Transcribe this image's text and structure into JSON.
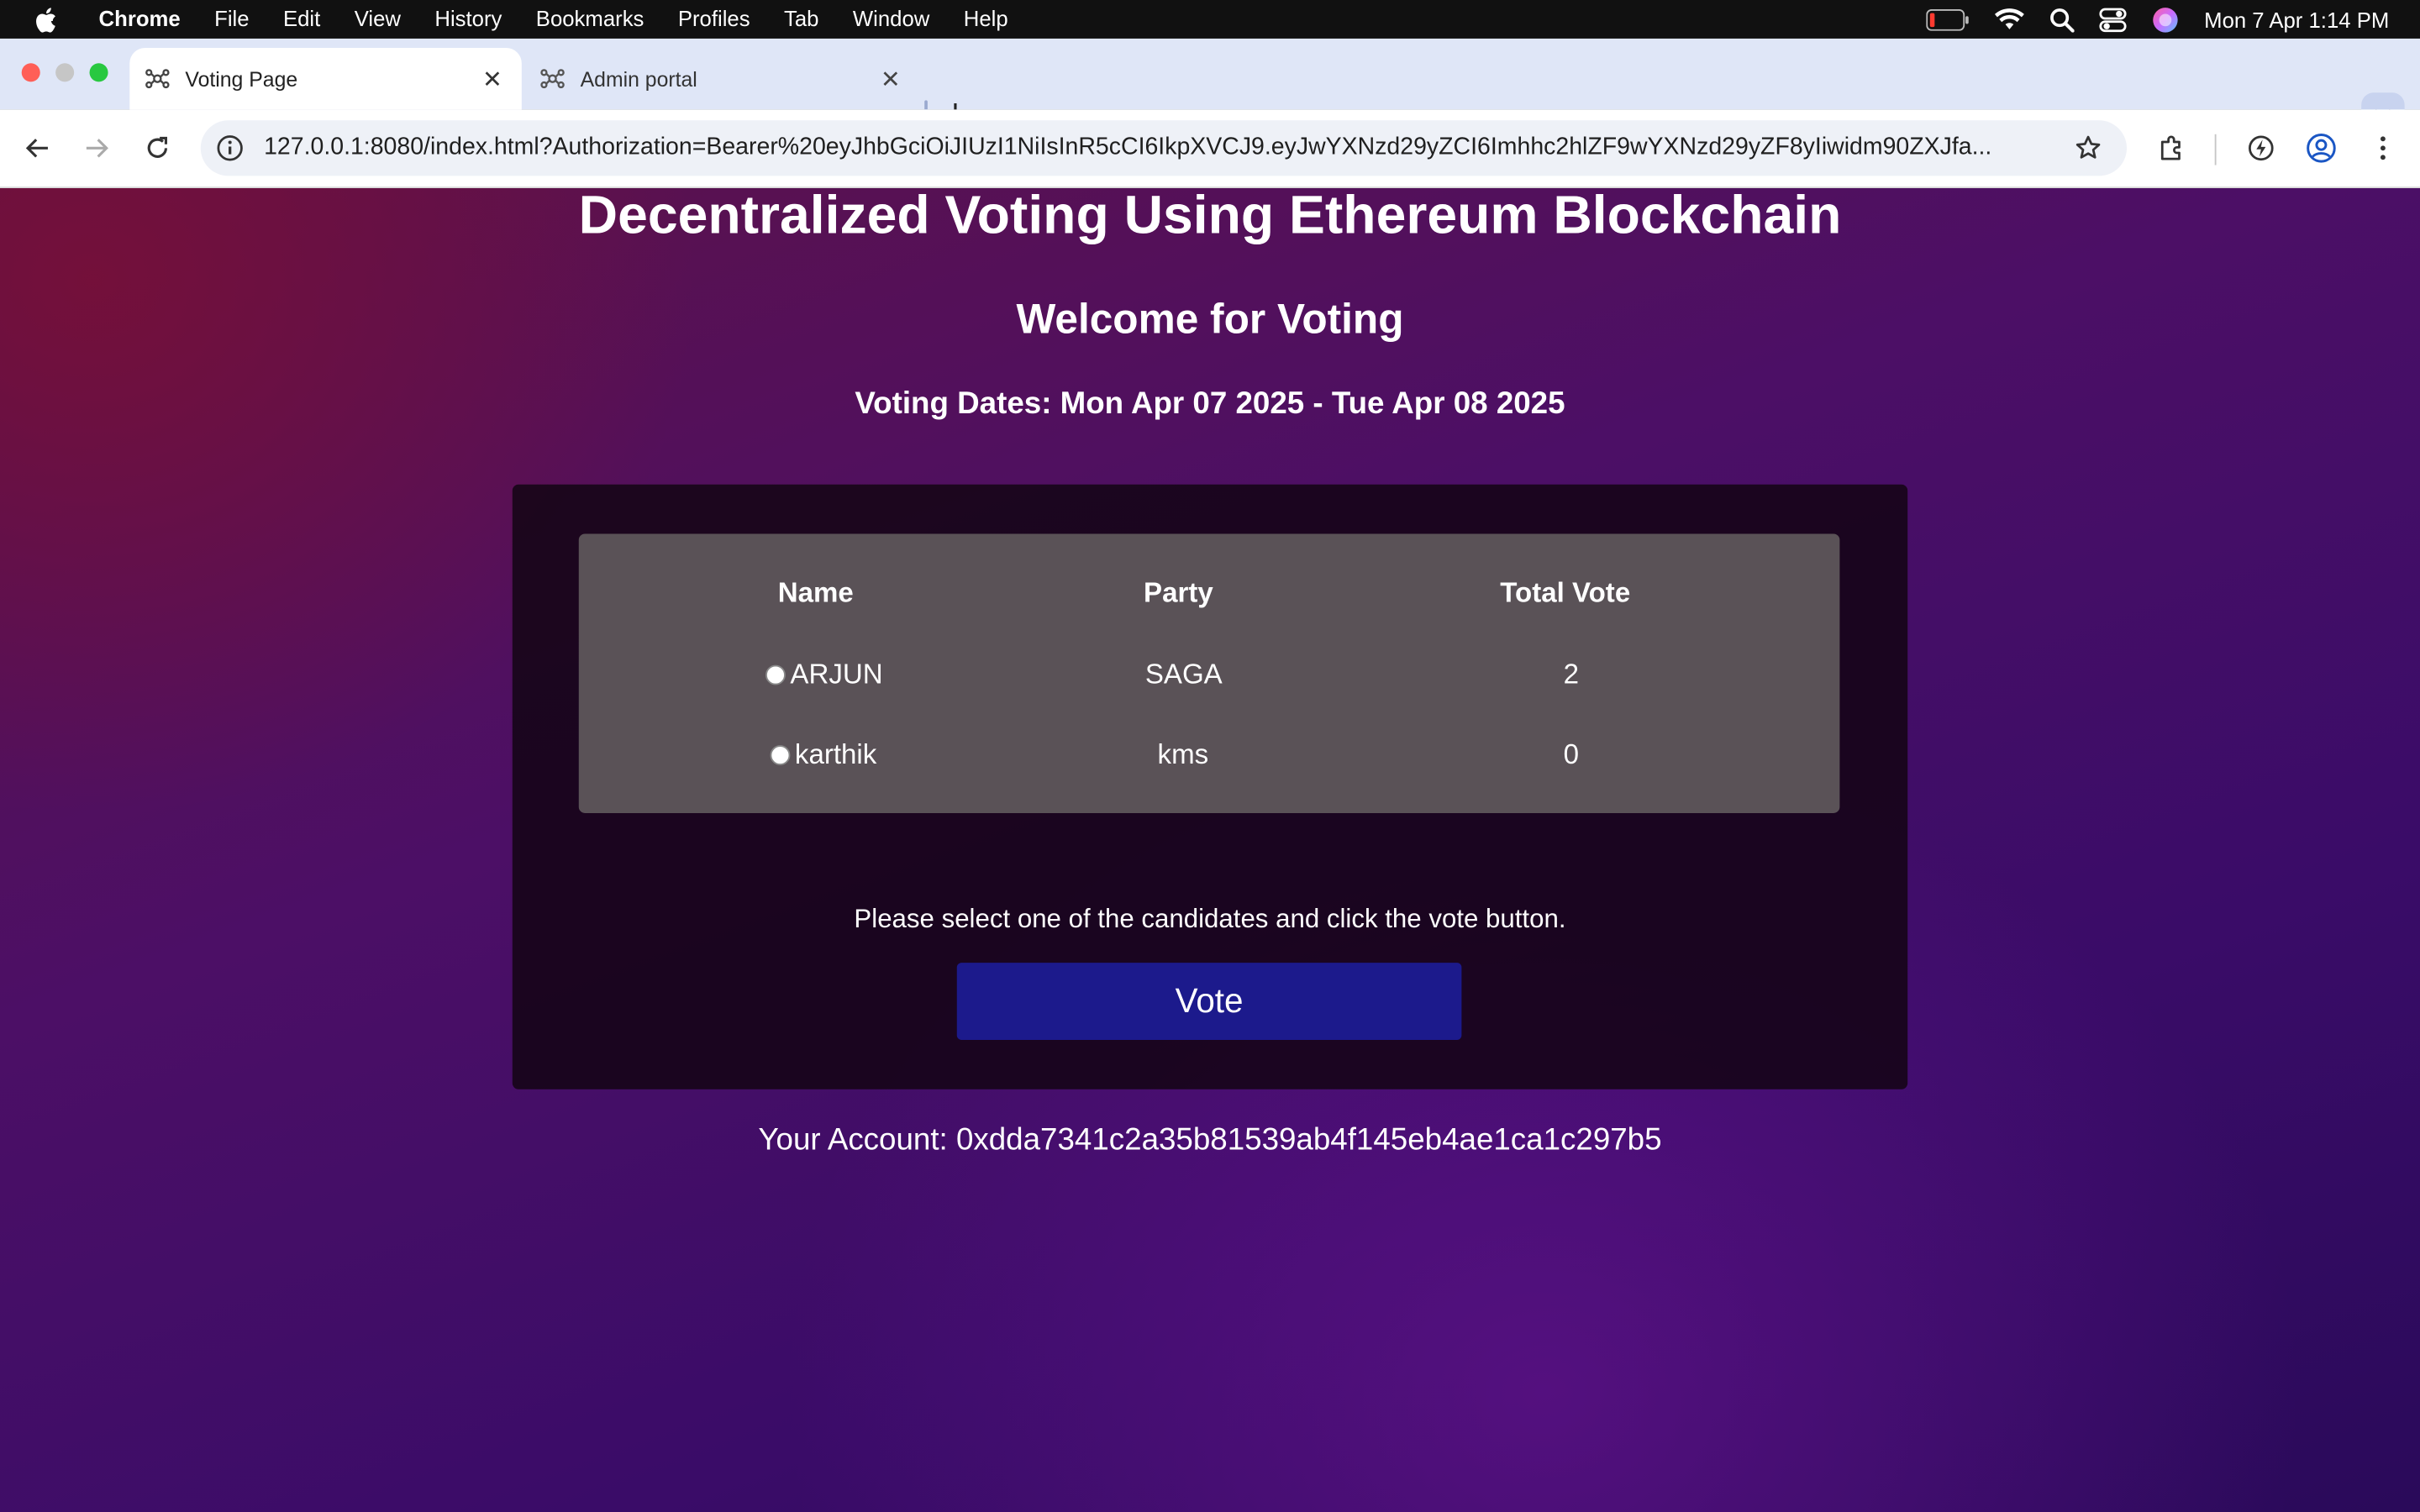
{
  "menubar": {
    "app_name": "Chrome",
    "items": [
      "File",
      "Edit",
      "View",
      "History",
      "Bookmarks",
      "Profiles",
      "Tab",
      "Window",
      "Help"
    ],
    "clock": "Mon 7 Apr  1:14 PM",
    "icons": [
      "apple-icon",
      "battery-icon",
      "wifi-icon",
      "spotlight-icon",
      "control-center-icon",
      "siri-icon"
    ]
  },
  "tabs": [
    {
      "title": "Voting Page",
      "active": true
    },
    {
      "title": "Admin portal",
      "active": false
    }
  ],
  "toolbar": {
    "url": "127.0.0.1:8080/index.html?Authorization=Bearer%20eyJhbGciOiJIUzI1NiIsInR5cCI6IkpXVCJ9.eyJwYXNzd29yZCI6Imhhc2hlZF9wYXNzd29yZF8yIiwidm90ZXJfa..."
  },
  "page": {
    "title": "Decentralized Voting Using Ethereum Blockchain",
    "welcome": "Welcome for Voting",
    "dates": "Voting Dates: Mon Apr 07 2025 - Tue Apr 08 2025",
    "table": {
      "headers": {
        "name": "Name",
        "party": "Party",
        "votes": "Total Vote"
      },
      "rows": [
        {
          "name": "ARJUN",
          "party": "SAGA",
          "votes": "2"
        },
        {
          "name": "karthik",
          "party": "kms",
          "votes": "0"
        }
      ]
    },
    "instruction": "Please select one of the candidates and click the vote button.",
    "vote_label": "Vote",
    "account": "Your Account: 0xdda7341c2a35b81539ab4f145eb4ae1ca1c297b5"
  },
  "colors": {
    "vote_button": "#1c1a8c",
    "table_bg": "#5a5257",
    "panel_bg": "#14041a",
    "tab_strip": "#dfe6f7"
  }
}
